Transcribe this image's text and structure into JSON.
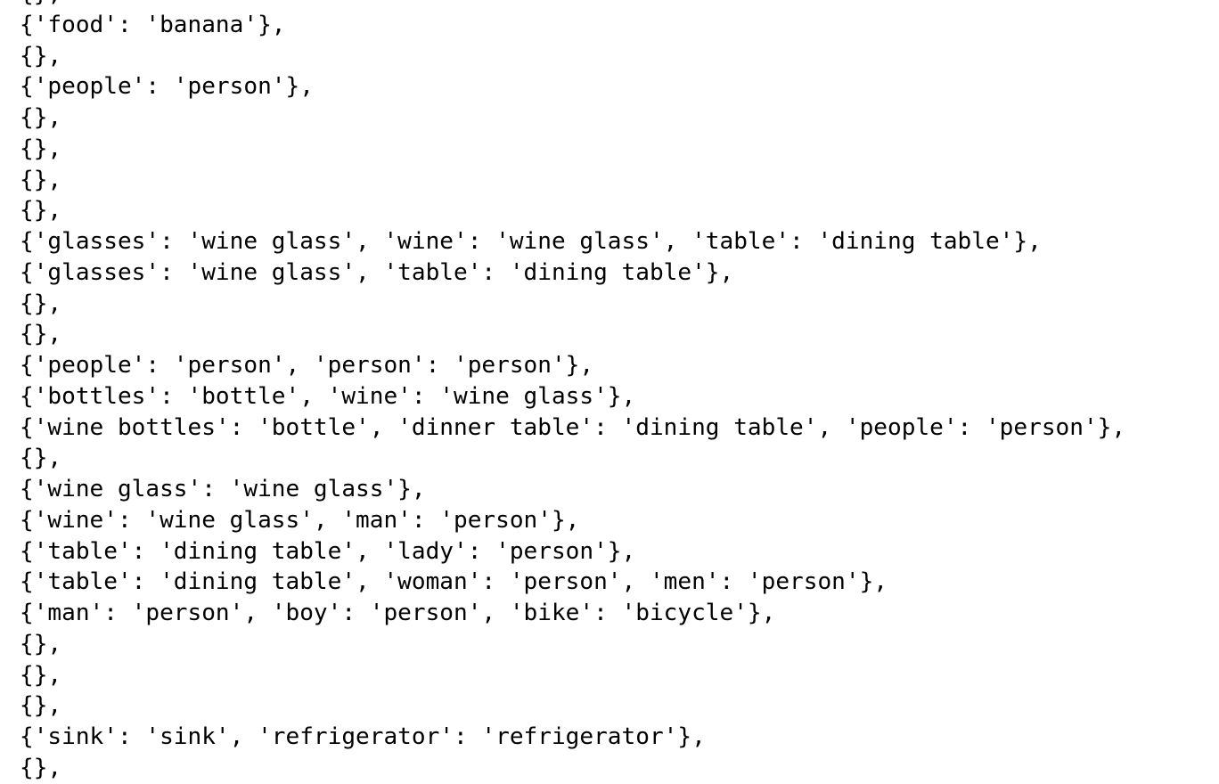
{
  "output": {
    "lines": [
      "{},",
      "{'food': 'banana'},",
      "{},",
      "{'people': 'person'},",
      "{},",
      "{},",
      "{},",
      "{},",
      "{'glasses': 'wine glass', 'wine': 'wine glass', 'table': 'dining table'},",
      "{'glasses': 'wine glass', 'table': 'dining table'},",
      "{},",
      "{},",
      "{'people': 'person', 'person': 'person'},",
      "{'bottles': 'bottle', 'wine': 'wine glass'},",
      "{'wine bottles': 'bottle', 'dinner table': 'dining table', 'people': 'person'},",
      "{},",
      "{'wine glass': 'wine glass'},",
      "{'wine': 'wine glass', 'man': 'person'},",
      "{'table': 'dining table', 'lady': 'person'},",
      "{'table': 'dining table', 'woman': 'person', 'men': 'person'},",
      "{'man': 'person', 'boy': 'person', 'bike': 'bicycle'},",
      "{},",
      "{},",
      "{},",
      "{'sink': 'sink', 'refrigerator': 'refrigerator'},",
      "{},"
    ]
  }
}
